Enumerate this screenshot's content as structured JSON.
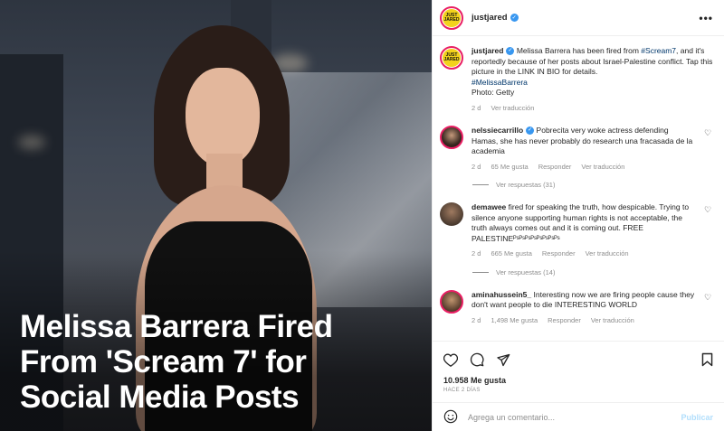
{
  "post": {
    "headline_lines": [
      "Melissa Barrera Fired",
      "From 'Scream 7' for",
      "Social Media Posts"
    ],
    "account": {
      "username": "justjared",
      "avatar_text": "JUST JARED",
      "more_label": "•••"
    },
    "caption": {
      "username": "justjared",
      "text_before": "Melissa Barrera has been fired from ",
      "hashtag1": "#Scream7",
      "text_after": ", and it's reportedly because of her posts about Israel-Palestine conflict. Tap this picture in the LINK IN BIO for details.",
      "hashtag2": "#MelissaBarrera",
      "photo_credit": "Photo: Getty",
      "time": "2 d",
      "translate": "Ver traducción"
    }
  },
  "comments": [
    {
      "username": "nelssiecarrillo",
      "verified": true,
      "text": "Pobrecita very woke actress defending Hamas, she has never probably do research una fracasada de la academia",
      "time": "2 d",
      "likes": "65 Me gusta",
      "reply": "Responder",
      "translate": "Ver traducción",
      "replies_label": "Ver respuestas (31)"
    },
    {
      "username": "demawee",
      "verified": false,
      "text": "fired for speaking the truth, how despicable. Trying to silence anyone supporting human rights is not acceptable, the truth always comes out and it is coming out. FREE PALESTINEᴾˢᴾˢᴾˢᴾˢᴾˢᴾˢᴾˢᴾˢ",
      "time": "2 d",
      "likes": "665 Me gusta",
      "reply": "Responder",
      "translate": "Ver traducción",
      "replies_label": "Ver respuestas (14)"
    },
    {
      "username": "aminahussein5_",
      "verified": false,
      "text": "Interesting now we are firing people cause they don't want people to die INTERESTING WORLD",
      "time": "2 d",
      "likes": "1,498 Me gusta",
      "reply": "Responder",
      "translate": "Ver traducción",
      "replies_label": ""
    }
  ],
  "footer": {
    "likes": "10.958 Me gusta",
    "time_ago": "HACE 2 DÍAS",
    "comment_placeholder": "Agrega un comentario...",
    "post_button": "Publicar"
  },
  "icons": {
    "like": "heart-icon",
    "comment": "comment-icon",
    "share": "share-icon",
    "save": "bookmark-icon",
    "emoji": "emoji-icon"
  },
  "colors": {
    "verified": "#3897f0",
    "link": "#00376b",
    "muted": "#8e8e8e",
    "post_button": "#b2dffc"
  }
}
